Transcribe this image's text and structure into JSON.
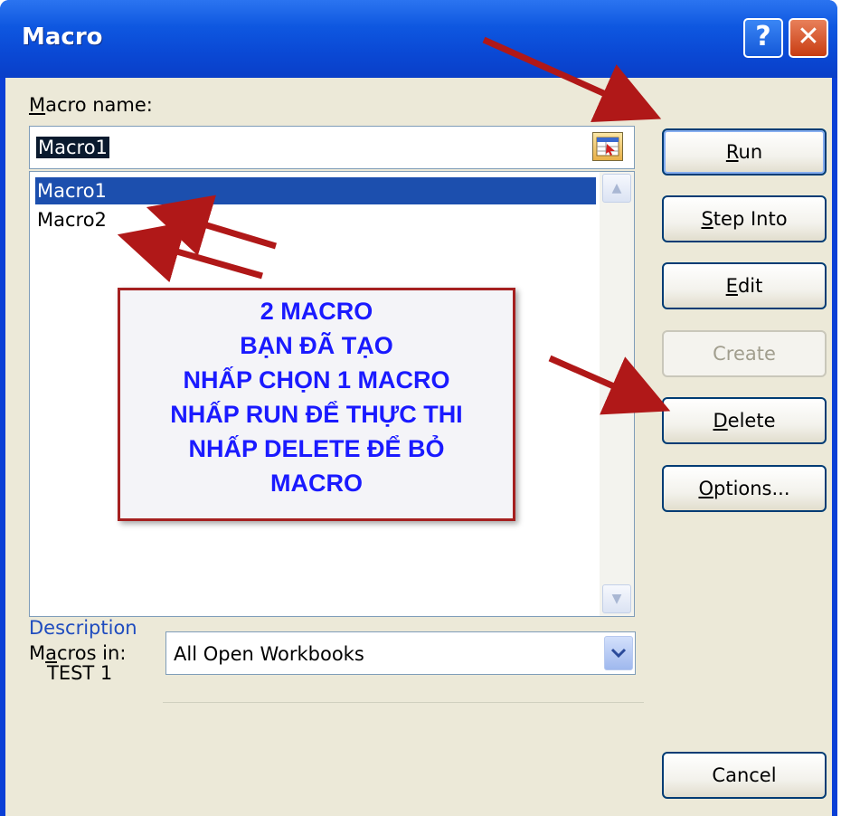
{
  "window": {
    "title": "Macro",
    "help_glyph": "?",
    "close_glyph": "✕"
  },
  "macro_name": {
    "label_first": "M",
    "label_rest": "acro name:",
    "value": "Macro1"
  },
  "macro_list": {
    "items": [
      "Macro1",
      "Macro2"
    ],
    "selected": "Macro1"
  },
  "annotation": {
    "lines": [
      "2 MACRO",
      "BẠN ĐÃ TẠO",
      "NHẤP CHỌN 1 MACRO",
      "NHẤP RUN ĐỂ THỰC THI",
      "NHẤP DELETE ĐỂ BỎ",
      "MACRO"
    ],
    "text_color": "#1a1aff",
    "border_color": "#a52020",
    "arrow_color": "#b01818"
  },
  "buttons": {
    "run": {
      "key": "R",
      "rest": "un"
    },
    "step_into": {
      "key": "S",
      "rest": "tep Into"
    },
    "edit": {
      "key": "E",
      "rest": "dit"
    },
    "create": {
      "label": "Create",
      "enabled": false
    },
    "delete": {
      "key": "D",
      "rest": "elete"
    },
    "options": {
      "key": "O",
      "rest": "ptions..."
    },
    "cancel": {
      "label": "Cancel"
    }
  },
  "macros_in": {
    "label_first": "M",
    "label_key": "a",
    "label_rest": "cros in:",
    "value": "All Open Workbooks"
  },
  "description": {
    "label": "Description",
    "text": "TEST 1",
    "label_color": "#1f4cbf"
  },
  "colors": {
    "titlebar": "#0a48d4",
    "dialog_bg": "#ece9d8",
    "selection": "#1c4fae"
  }
}
